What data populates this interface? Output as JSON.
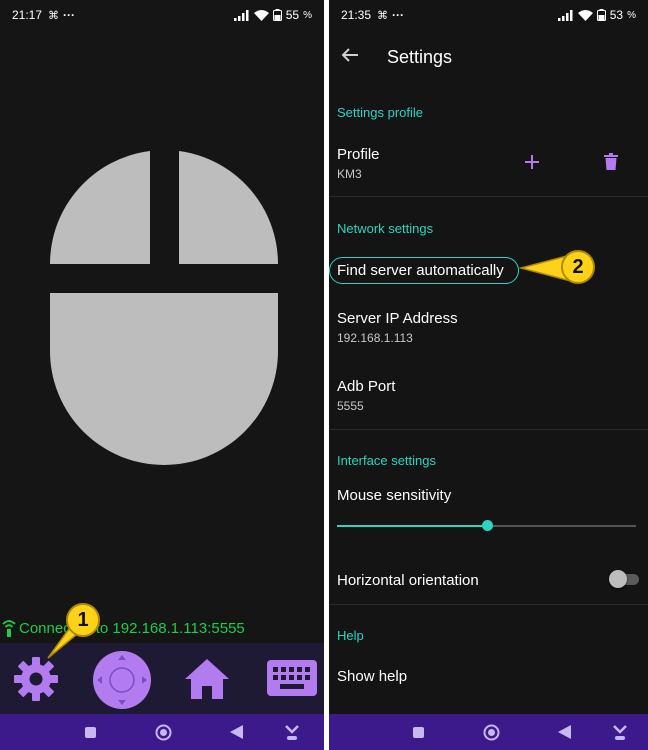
{
  "left_screen": {
    "status": {
      "time": "21:17",
      "extra_icon": "⌘",
      "dots": "···",
      "battery": "55"
    },
    "mouse": {
      "icon": "mouse-pad-icon"
    },
    "connection": {
      "text": "Connected to 192.168.1.113:5555"
    },
    "toolbar": {
      "settings_icon": "gear-icon",
      "dpad_icon": "dpad-icon",
      "home_icon": "home-icon",
      "keyboard_icon": "keyboard-icon"
    },
    "callout": {
      "number": "1"
    }
  },
  "right_screen": {
    "status": {
      "time": "21:35",
      "extra_icon": "⌘",
      "dots": "···",
      "battery": "53"
    },
    "appbar": {
      "title": "Settings"
    },
    "settings_profile": {
      "header": "Settings profile",
      "profile_label": "Profile",
      "profile_value": "KM3"
    },
    "network": {
      "header": "Network settings",
      "find_server": "Find server automatically",
      "server_ip_label": "Server IP Address",
      "server_ip_value": "192.168.1.113",
      "adb_port_label": "Adb Port",
      "adb_port_value": "5555"
    },
    "interface": {
      "header": "Interface settings",
      "mouse_sensitivity_label": "Mouse sensitivity",
      "mouse_sensitivity_fraction": 0.5,
      "horizontal_orientation_label": "Horizontal orientation",
      "horizontal_orientation_on": false
    },
    "help": {
      "header": "Help",
      "show_help": "Show help"
    },
    "callout": {
      "number": "2"
    }
  },
  "colors": {
    "accent_teal": "#2ed3c1",
    "accent_purple": "#b27cf0",
    "navbar": "#3c1a8c",
    "connection_green": "#1fcc4a",
    "callout_yellow": "#ffd21a"
  }
}
